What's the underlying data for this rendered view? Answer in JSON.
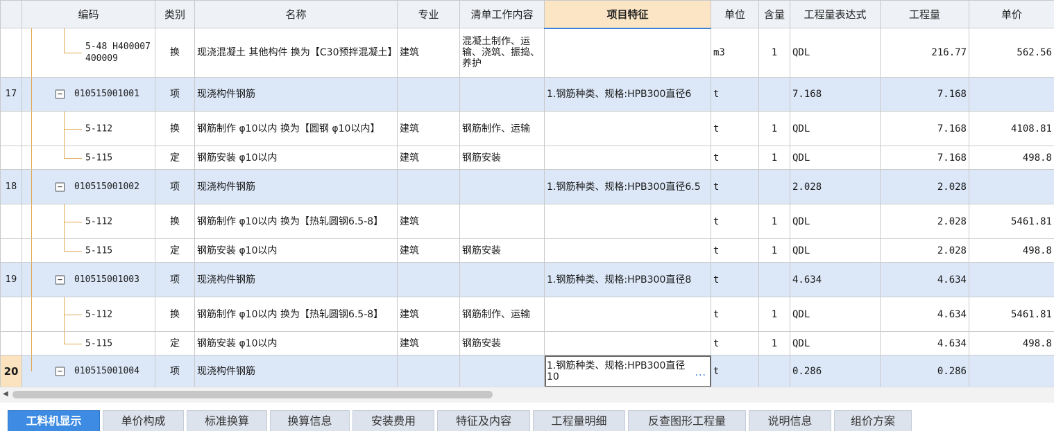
{
  "columns": {
    "code": "编码",
    "type": "类别",
    "name": "名称",
    "major": "专业",
    "work": "清单工作内容",
    "feature": "项目特征",
    "unit": "单位",
    "content": "含量",
    "expr": "工程量表达式",
    "qty": "工程量",
    "price": "单价"
  },
  "rows": [
    {
      "idx": "",
      "code": "5-48 H400007 400009",
      "type": "换",
      "name": "现浇混凝土 其他构件  换为【C30预拌混凝土】",
      "major": "建筑",
      "work": "混凝土制作、运输、浇筑、振捣、养护",
      "feature": "",
      "unit": "m3",
      "content": "1",
      "expr": "QDL",
      "qty": "216.77",
      "price": "562.56"
    },
    {
      "idx": "17",
      "code": "010515001001",
      "type": "项",
      "name": "现浇构件钢筋",
      "major": "",
      "work": "",
      "feature": "1.钢筋种类、规格:HPB300直径6",
      "unit": "t",
      "content": "",
      "expr": "7.168",
      "qty": "7.168",
      "price": ""
    },
    {
      "idx": "",
      "code": "5-112",
      "type": "换",
      "name": "钢筋制作 φ10以内  换为【圆钢 φ10以内】",
      "major": "建筑",
      "work": "钢筋制作、运输",
      "feature": "",
      "unit": "t",
      "content": "1",
      "expr": "QDL",
      "qty": "7.168",
      "price": "4108.81"
    },
    {
      "idx": "",
      "code": "5-115",
      "type": "定",
      "name": "钢筋安装 φ10以内",
      "major": "建筑",
      "work": "钢筋安装",
      "feature": "",
      "unit": "t",
      "content": "1",
      "expr": "QDL",
      "qty": "7.168",
      "price": "498.8"
    },
    {
      "idx": "18",
      "code": "010515001002",
      "type": "项",
      "name": "现浇构件钢筋",
      "major": "",
      "work": "",
      "feature": "1.钢筋种类、规格:HPB300直径6.5",
      "unit": "t",
      "content": "",
      "expr": "2.028",
      "qty": "2.028",
      "price": ""
    },
    {
      "idx": "",
      "code": "5-112",
      "type": "换",
      "name": "钢筋制作 φ10以内  换为【热轧圆钢6.5-8】",
      "major": "建筑",
      "work": "",
      "feature": "",
      "unit": "t",
      "content": "1",
      "expr": "QDL",
      "qty": "2.028",
      "price": "5461.81"
    },
    {
      "idx": "",
      "code": "5-115",
      "type": "定",
      "name": "钢筋安装 φ10以内",
      "major": "建筑",
      "work": "钢筋安装",
      "feature": "",
      "unit": "t",
      "content": "1",
      "expr": "QDL",
      "qty": "2.028",
      "price": "498.8"
    },
    {
      "idx": "19",
      "code": "010515001003",
      "type": "项",
      "name": "现浇构件钢筋",
      "major": "",
      "work": "",
      "feature": "1.钢筋种类、规格:HPB300直径8",
      "unit": "t",
      "content": "",
      "expr": "4.634",
      "qty": "4.634",
      "price": ""
    },
    {
      "idx": "",
      "code": "5-112",
      "type": "换",
      "name": "钢筋制作 φ10以内  换为【热轧圆钢6.5-8】",
      "major": "建筑",
      "work": "钢筋制作、运输",
      "feature": "",
      "unit": "t",
      "content": "1",
      "expr": "QDL",
      "qty": "4.634",
      "price": "5461.81"
    },
    {
      "idx": "",
      "code": "5-115",
      "type": "定",
      "name": "钢筋安装 φ10以内",
      "major": "建筑",
      "work": "钢筋安装",
      "feature": "",
      "unit": "t",
      "content": "1",
      "expr": "QDL",
      "qty": "4.634",
      "price": "498.8"
    },
    {
      "idx": "20",
      "code": "010515001004",
      "type": "项",
      "name": "现浇构件钢筋",
      "major": "",
      "work": "",
      "feature": "1.钢筋种类、规格:HPB300直径10",
      "unit": "t",
      "content": "",
      "expr": "0.286",
      "qty": "0.286",
      "price": ""
    }
  ],
  "editor_ellipsis": "···",
  "tabs": [
    "工料机显示",
    "单价构成",
    "标准换算",
    "换算信息",
    "安装费用",
    "特征及内容",
    "工程量明细",
    "反查图形工程量",
    "说明信息",
    "组价方案"
  ],
  "colors": {
    "active_tab": "#3d8be3",
    "group_row": "#dce8f8",
    "header_highlight": "#fce5c5",
    "tree_line": "#e0a64a"
  }
}
